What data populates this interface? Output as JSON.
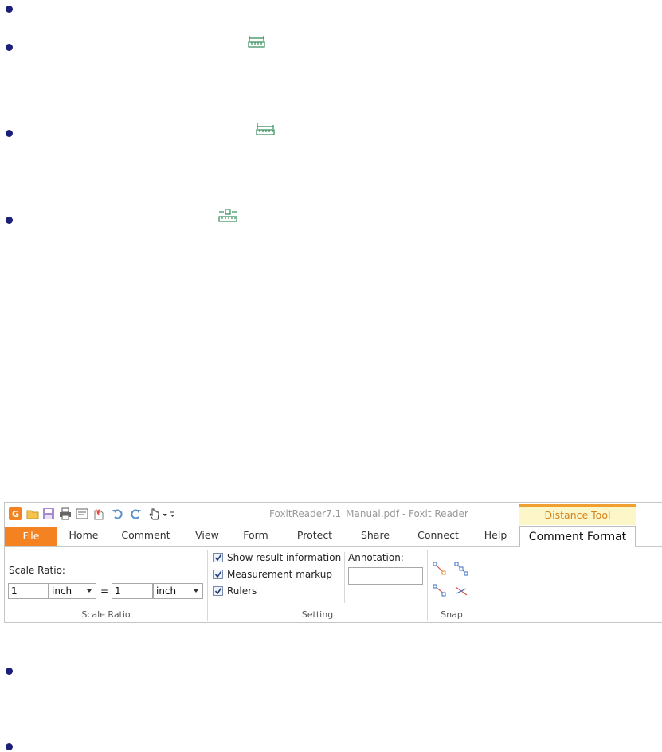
{
  "window": {
    "title": "FoxitReader7.1_Manual.pdf - Foxit Reader",
    "contextual_tab": "Distance Tool"
  },
  "colors": {
    "file_tab": "#f58220",
    "contextual_accent": "#f0a030",
    "contextual_bg": "#fdf6c8",
    "bullet": "#1b1f7a",
    "ruler_icon": "#2e8b57"
  },
  "quick_access": [
    "foxit-logo-icon",
    "open-icon",
    "save-icon",
    "print-icon",
    "properties-icon",
    "new-icon",
    "undo-icon",
    "redo-icon",
    "hand-tool-icon",
    "customize-icon"
  ],
  "tabs": [
    {
      "label": "File"
    },
    {
      "label": "Home"
    },
    {
      "label": "Comment"
    },
    {
      "label": "View"
    },
    {
      "label": "Form"
    },
    {
      "label": "Protect"
    },
    {
      "label": "Share"
    },
    {
      "label": "Connect"
    },
    {
      "label": "Help"
    },
    {
      "label": "Comment Format"
    }
  ],
  "scale_ratio": {
    "label": "Scale Ratio:",
    "left_value": "1",
    "left_unit": "inch",
    "equals": "=",
    "right_value": "1",
    "right_unit": "inch",
    "group_label": "Scale Ratio"
  },
  "setting": {
    "options": [
      {
        "label": "Show result information",
        "checked": true
      },
      {
        "label": "Measurement markup",
        "checked": true
      },
      {
        "label": "Rulers",
        "checked": true
      }
    ],
    "annotation_label": "Annotation:",
    "annotation_value": "",
    "group_label": "Setting"
  },
  "snap": {
    "group_label": "Snap",
    "icons": [
      "snap-endpoint-icon",
      "snap-midpoint-icon",
      "snap-path-icon",
      "snap-intersection-icon"
    ]
  }
}
